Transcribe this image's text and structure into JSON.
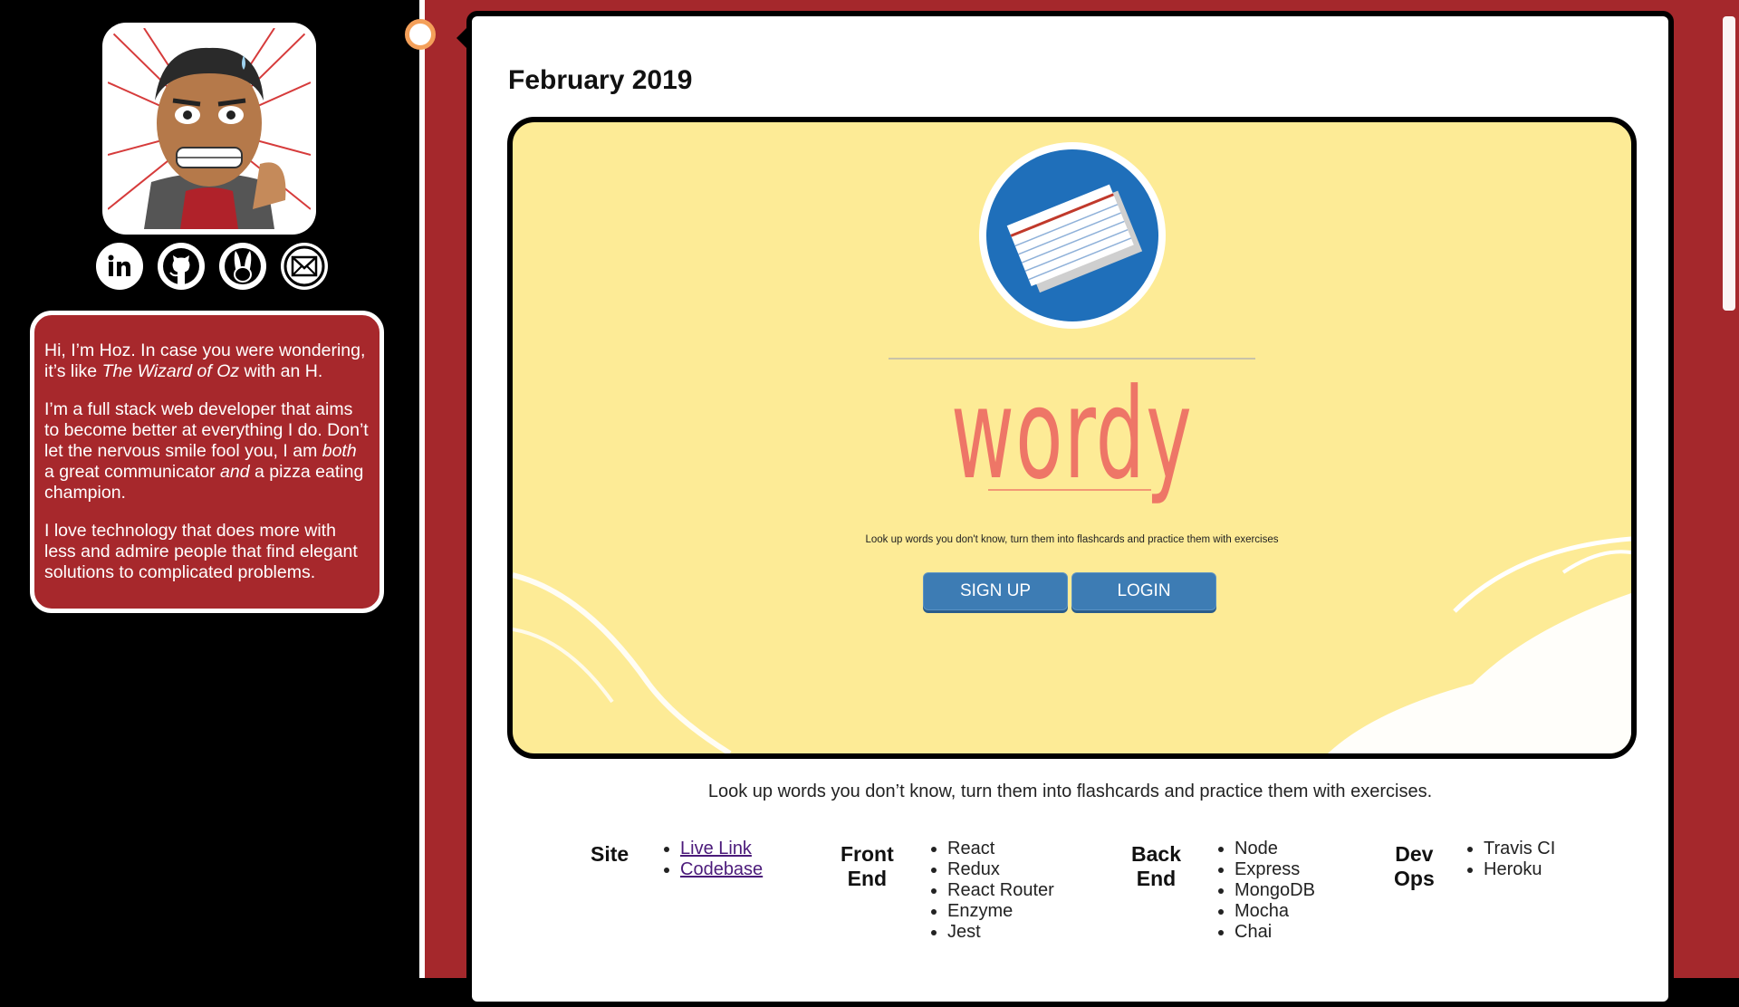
{
  "sidebar": {
    "social": [
      {
        "label": "LinkedIn",
        "icon": "linkedin-icon"
      },
      {
        "label": "GitHub",
        "icon": "github-icon"
      },
      {
        "label": "Bunny",
        "icon": "bunny-icon"
      },
      {
        "label": "Email",
        "icon": "mail-icon"
      }
    ],
    "bio": {
      "p1_a": "Hi, I’m Hoz. In case you were wondering, it’s like ",
      "p1_em": "The Wizard of Oz",
      "p1_b": " with an H.",
      "p2_a": "I’m a full stack web developer that aims to become better at everything I do. Don’t let the nervous smile fool you, I am ",
      "p2_em1": "both",
      "p2_b": " a great communicator ",
      "p2_em2": "and",
      "p2_c": " a pizza eating champion.",
      "p3": "I love technology that does more with less and admire people that find elegant solutions to complicated problems."
    }
  },
  "card": {
    "title": "February 2019",
    "preview": {
      "app_name": "wordy",
      "tagline": "Look up words you don't know, turn them into flashcards and practice them with exercises",
      "signup_label": "SIGN UP",
      "login_label": "LOGIN"
    },
    "description": "Look up words you don’t know, turn them into flashcards and practice them with exercises.",
    "tech": {
      "site": {
        "heading": "Site",
        "items": [
          "Live Link",
          "Codebase"
        ]
      },
      "front_end": {
        "heading_1": "Front",
        "heading_2": "End",
        "items": [
          "React",
          "Redux",
          "React Router",
          "Enzyme",
          "Jest"
        ]
      },
      "back_end": {
        "heading_1": "Back",
        "heading_2": "End",
        "items": [
          "Node",
          "Express",
          "MongoDB",
          "Mocha",
          "Chai"
        ]
      },
      "dev_ops": {
        "heading_1": "Dev",
        "heading_2": "Ops",
        "items": [
          "Travis CI",
          "Heroku"
        ]
      }
    }
  },
  "colors": {
    "accent_red": "#a5282c",
    "preview_yellow": "#fdeb96",
    "wordy_coral": "#ee7667",
    "button_blue": "#3d7cb4",
    "timeline_dot_orange": "#f4a05a"
  }
}
